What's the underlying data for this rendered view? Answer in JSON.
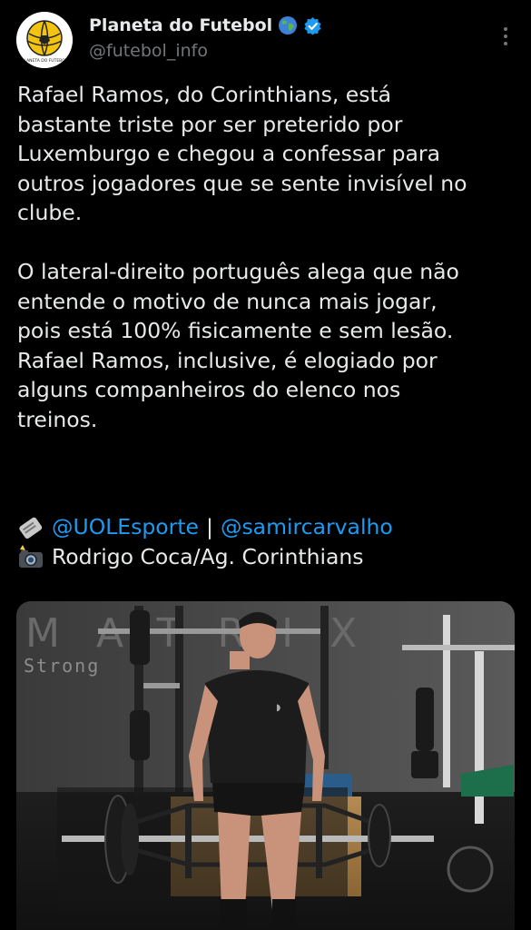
{
  "author": {
    "display_name": "Planeta do Futebol",
    "handle": "@futebol_info",
    "avatar_text": "PLANETA DO FUTEBOL"
  },
  "icons": {
    "globe": "globe-emoji-icon",
    "verified": "verified-badge-icon",
    "more": "more-options-icon",
    "newspaper": "newspaper-emoji-icon",
    "camera": "camera-flash-emoji-icon"
  },
  "tweet": {
    "text": "Rafael Ramos, do Corinthians, está\nbastante triste por ser preterido por\nLuxemburgo e chegou a confessar para\noutros jogadores que se sente invisível no\nclube.\n\nO lateral-direito português alega que não\nentende o motivo de nunca mais jogar,\npois está 100% fisicamente e sem lesão.\nRafael Ramos, inclusive, é elogiado por\nalguns companheiros do elenco nos\ntreinos.",
    "source_link_1": "@UOLEsporte",
    "separator": "|",
    "source_link_2": "@samircarvalho",
    "photo_credit": "Rodrigo Coca/Ag. Corinthians"
  },
  "media": {
    "wall_text_1": "MATRIX",
    "wall_text_2": "Strong"
  },
  "colors": {
    "background": "#000000",
    "text": "#e7e9ea",
    "secondary": "#71767b",
    "link": "#1d9bf0",
    "verified": "#1d9bf0"
  }
}
